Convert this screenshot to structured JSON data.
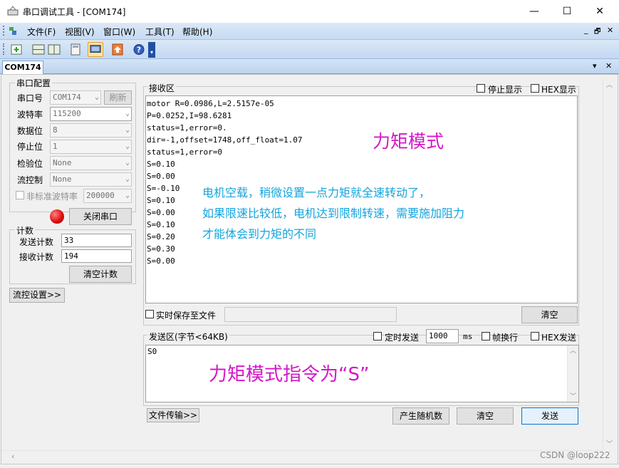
{
  "window": {
    "title": "串口调试工具 - [COM174]",
    "minimize_glyph": "—",
    "maximize_glyph": "☐",
    "close_glyph": "✕"
  },
  "menu": {
    "items": [
      "文件(F)",
      "视图(V)",
      "窗口(W)",
      "工具(T)",
      "帮助(H)"
    ],
    "right_glyphs": [
      "_",
      "🗗",
      "✕"
    ]
  },
  "toolbar": {
    "icons": [
      "new-icon",
      "split-horizontal-icon",
      "split-vertical-icon",
      "calculator-icon",
      "monitor-icon",
      "upload-icon",
      "help-icon"
    ]
  },
  "tab": {
    "label": "COM174",
    "dropdown_glyph": "▾",
    "close_glyph": "✕"
  },
  "serial_config": {
    "group_title": "串口配置",
    "port_label": "串口号",
    "port_value": "COM174",
    "refresh_label": "刷新",
    "baud_label": "波特率",
    "baud_value": "115200",
    "databits_label": "数据位",
    "databits_value": "8",
    "stopbits_label": "停止位",
    "stopbits_value": "1",
    "parity_label": "检验位",
    "parity_value": "None",
    "flow_label": "流控制",
    "flow_value": "None",
    "nonstd_label": "非标准波特率",
    "nonstd_value": "200000",
    "close_port_label": "关闭串口"
  },
  "counter": {
    "group_title": "计数",
    "send_label": "发送计数",
    "send_value": "33",
    "recv_label": "接收计数",
    "recv_value": "194",
    "clear_label": "清空计数"
  },
  "flow_settings_label": "流控设置>>",
  "receive": {
    "group_title": "接收区",
    "stop_display_label": "停止显示",
    "hex_display_label": "HEX显示",
    "lines": [
      "motor R=0.0986,L=2.5157e-05",
      "P=0.0252,I=98.6281",
      "status=1,error=0.",
      "dir=-1,offset=1748,off_float=1.07",
      "status=1,error=0",
      "S=0.10",
      "S=0.00",
      "S=-0.10",
      "S=0.10",
      "S=0.00",
      "S=0.10",
      "S=0.20",
      "S=0.30",
      "S=0.00"
    ],
    "realtime_save_label": "实时保存至文件",
    "clear_label": "清空"
  },
  "send": {
    "group_title": "发送区(字节<64KB)",
    "timed_label": "定时发送",
    "interval_value": "1000",
    "interval_unit": "ms",
    "newline_label": "帧换行",
    "hex_send_label": "HEX发送",
    "content": "S0",
    "file_transfer_label": "文件传输>>",
    "random_label": "产生随机数",
    "clear_label": "清空",
    "send_label": "发送"
  },
  "annotations": {
    "torque_mode": "力矩模式",
    "line1": "电机空载，稍微设置一点力矩就全速转动了，",
    "line2": "如果限速比较低，电机达到限制转速，需要施加阻力",
    "line3": "才能体会到力矩的不同",
    "command": "力矩模式指令为“S”"
  },
  "watermark": "CSDN @loop222",
  "colors": {
    "annotation_magenta": "#d417c8",
    "annotation_cyan": "#14a4dd",
    "indicator_red": "#e01010",
    "accent_blue": "#0078d7"
  }
}
